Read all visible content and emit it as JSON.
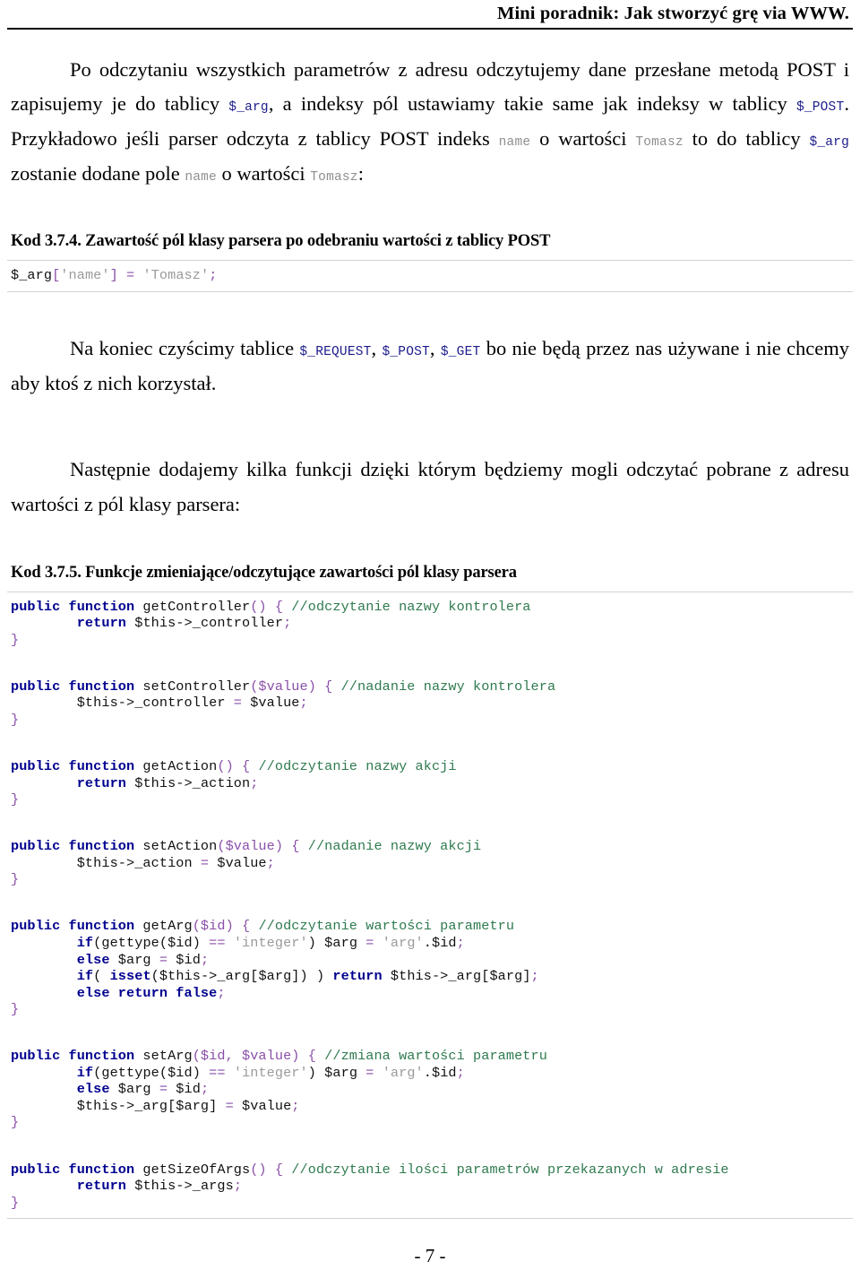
{
  "header": {
    "title": "Mini poradnik: Jak stworzyć grę via WWW."
  },
  "paragraphs": {
    "p1": {
      "part1": "Po odczytaniu wszystkich parametrów z adresu odczytujemy dane przesłane metodą POST i zapisujemy je do tablicy ",
      "code1": "$_arg",
      "part2": ", a indeksy pól ustawiamy takie same jak indeksy w tablicy ",
      "code2": "$_POST",
      "part3": ". Przykładowo jeśli parser odczyta z tablicy POST indeks ",
      "code3": "name",
      "part4": " o wartości ",
      "code4": "Tomasz",
      "part5": " to do tablicy ",
      "code5": "$_arg",
      "part6": " zostanie dodane pole ",
      "code6": "name",
      "part7": " o wartości ",
      "code7": "Tomasz",
      "part8": ":"
    },
    "p2": {
      "part1": "Na koniec czyścimy tablice ",
      "code1": "$_REQUEST",
      "part2": ", ",
      "code2": "$_POST",
      "part3": ", ",
      "code3": "$_GET",
      "part4": " bo nie będą przez nas używane i nie chcemy aby ktoś z nich korzystał."
    },
    "p3": {
      "text": "Następnie dodajemy kilka funkcji dzięki którym będziemy mogli odczytać pobrane z adresu wartości z pól klasy parsera:"
    }
  },
  "listings": [
    {
      "caption": "Kod 3.7.4. Zawartość pól klasy parsera po odebraniu wartości z tablicy POST",
      "code_plain": "$_arg['name'] = 'Tomasz';"
    },
    {
      "caption": "Kod 3.7.5. Funkcje zmieniające/odczytujące zawartości pól klasy parsera",
      "code_plain": "public function getController() { //odczytanie nazwy kontrolera\n        return $this->_controller;\n}\n\npublic function setController($value) { //nadanie nazwy kontrolera\n        $this->_controller = $value;\n}\n\npublic function getAction() { //odczytanie nazwy akcji\n        return $this->_action;\n}\n\npublic function setAction($value) { //nadanie nazwy akcji\n        $this->_action = $value;\n}\n\npublic function getArg($id) { //odczytanie wartości parametru\n        if(gettype($id) == 'integer') $arg = 'arg'.$id;\n        else $arg = $id;\n        if( isset($this->_arg[$arg]) ) return $this->_arg[$arg];\n        else return false;\n}\n\npublic function setArg($id, $value) { //zmiana wartości parametru\n        if(gettype($id) == 'integer') $arg = 'arg'.$id;\n        else $arg = $id;\n        $this->_arg[$arg] = $value;\n}\n\npublic function getSizeOfArgs() { //odczytanie ilości parametrów przekazanych w adresie\n        return $this->_args;\n}"
    }
  ],
  "code_tokens": {
    "listing1": [
      [
        {
          "t": "$_arg",
          "c": "var"
        },
        {
          "t": "[",
          "c": "punc"
        },
        {
          "t": "'name'",
          "c": "str"
        },
        {
          "t": "]",
          "c": "punc"
        },
        {
          "t": " ",
          "c": "var"
        },
        {
          "t": "=",
          "c": "op"
        },
        {
          "t": " ",
          "c": "var"
        },
        {
          "t": "'Tomasz'",
          "c": "str"
        },
        {
          "t": ";",
          "c": "punc"
        }
      ]
    ],
    "listing2": [
      [
        {
          "t": "public function",
          "c": "kw"
        },
        {
          "t": " getController",
          "c": "fn"
        },
        {
          "t": "()",
          "c": "punc"
        },
        {
          "t": " ",
          "c": "var"
        },
        {
          "t": "{",
          "c": "punc"
        },
        {
          "t": " //odczytanie nazwy kontrolera",
          "c": "cmt"
        }
      ],
      [
        {
          "t": "        ",
          "c": "var"
        },
        {
          "t": "return",
          "c": "kw"
        },
        {
          "t": " $this->_controller",
          "c": "var"
        },
        {
          "t": ";",
          "c": "punc"
        }
      ],
      [
        {
          "t": "}",
          "c": "punc"
        }
      ],
      [
        {
          "t": "",
          "c": "blank"
        }
      ],
      [
        {
          "t": "public function",
          "c": "kw"
        },
        {
          "t": " setController",
          "c": "fn"
        },
        {
          "t": "($value)",
          "c": "punc"
        },
        {
          "t": " ",
          "c": "var"
        },
        {
          "t": "{",
          "c": "punc"
        },
        {
          "t": " //nadanie nazwy kontrolera",
          "c": "cmt"
        }
      ],
      [
        {
          "t": "        $this->_controller ",
          "c": "var"
        },
        {
          "t": "=",
          "c": "op"
        },
        {
          "t": " $value",
          "c": "var"
        },
        {
          "t": ";",
          "c": "punc"
        }
      ],
      [
        {
          "t": "}",
          "c": "punc"
        }
      ],
      [
        {
          "t": "",
          "c": "blank"
        }
      ],
      [
        {
          "t": "public function",
          "c": "kw"
        },
        {
          "t": " getAction",
          "c": "fn"
        },
        {
          "t": "()",
          "c": "punc"
        },
        {
          "t": " ",
          "c": "var"
        },
        {
          "t": "{",
          "c": "punc"
        },
        {
          "t": " //odczytanie nazwy akcji",
          "c": "cmt"
        }
      ],
      [
        {
          "t": "        ",
          "c": "var"
        },
        {
          "t": "return",
          "c": "kw"
        },
        {
          "t": " $this->_action",
          "c": "var"
        },
        {
          "t": ";",
          "c": "punc"
        }
      ],
      [
        {
          "t": "}",
          "c": "punc"
        }
      ],
      [
        {
          "t": "",
          "c": "blank"
        }
      ],
      [
        {
          "t": "public function",
          "c": "kw"
        },
        {
          "t": " setAction",
          "c": "fn"
        },
        {
          "t": "($value)",
          "c": "punc"
        },
        {
          "t": " ",
          "c": "var"
        },
        {
          "t": "{",
          "c": "punc"
        },
        {
          "t": " //nadanie nazwy akcji",
          "c": "cmt"
        }
      ],
      [
        {
          "t": "        $this->_action ",
          "c": "var"
        },
        {
          "t": "=",
          "c": "op"
        },
        {
          "t": " $value",
          "c": "var"
        },
        {
          "t": ";",
          "c": "punc"
        }
      ],
      [
        {
          "t": "}",
          "c": "punc"
        }
      ],
      [
        {
          "t": "",
          "c": "blank"
        }
      ],
      [
        {
          "t": "public function",
          "c": "kw"
        },
        {
          "t": " getArg",
          "c": "fn"
        },
        {
          "t": "($id)",
          "c": "punc"
        },
        {
          "t": " ",
          "c": "var"
        },
        {
          "t": "{",
          "c": "punc"
        },
        {
          "t": " //odczytanie wartości parametru",
          "c": "cmt"
        }
      ],
      [
        {
          "t": "        ",
          "c": "var"
        },
        {
          "t": "if",
          "c": "kw"
        },
        {
          "t": "(gettype($id) ",
          "c": "var"
        },
        {
          "t": "==",
          "c": "op"
        },
        {
          "t": " ",
          "c": "var"
        },
        {
          "t": "'integer'",
          "c": "str"
        },
        {
          "t": ") $arg ",
          "c": "var"
        },
        {
          "t": "=",
          "c": "op"
        },
        {
          "t": " ",
          "c": "var"
        },
        {
          "t": "'arg'",
          "c": "str"
        },
        {
          "t": ".$id",
          "c": "var"
        },
        {
          "t": ";",
          "c": "punc"
        }
      ],
      [
        {
          "t": "        ",
          "c": "var"
        },
        {
          "t": "else",
          "c": "kw"
        },
        {
          "t": " $arg ",
          "c": "var"
        },
        {
          "t": "=",
          "c": "op"
        },
        {
          "t": " $id",
          "c": "var"
        },
        {
          "t": ";",
          "c": "punc"
        }
      ],
      [
        {
          "t": "        ",
          "c": "var"
        },
        {
          "t": "if",
          "c": "kw"
        },
        {
          "t": "( ",
          "c": "var"
        },
        {
          "t": "isset",
          "c": "kw"
        },
        {
          "t": "($this->_arg[$arg]) ) ",
          "c": "var"
        },
        {
          "t": "return",
          "c": "kw"
        },
        {
          "t": " $this->_arg[$arg]",
          "c": "var"
        },
        {
          "t": ";",
          "c": "punc"
        }
      ],
      [
        {
          "t": "        ",
          "c": "var"
        },
        {
          "t": "else return false",
          "c": "kw"
        },
        {
          "t": ";",
          "c": "punc"
        }
      ],
      [
        {
          "t": "}",
          "c": "punc"
        }
      ],
      [
        {
          "t": "",
          "c": "blank"
        }
      ],
      [
        {
          "t": "public function",
          "c": "kw"
        },
        {
          "t": " setArg",
          "c": "fn"
        },
        {
          "t": "($id, $value)",
          "c": "punc"
        },
        {
          "t": " ",
          "c": "var"
        },
        {
          "t": "{",
          "c": "punc"
        },
        {
          "t": " //zmiana wartości parametru",
          "c": "cmt"
        }
      ],
      [
        {
          "t": "        ",
          "c": "var"
        },
        {
          "t": "if",
          "c": "kw"
        },
        {
          "t": "(gettype($id) ",
          "c": "var"
        },
        {
          "t": "==",
          "c": "op"
        },
        {
          "t": " ",
          "c": "var"
        },
        {
          "t": "'integer'",
          "c": "str"
        },
        {
          "t": ") $arg ",
          "c": "var"
        },
        {
          "t": "=",
          "c": "op"
        },
        {
          "t": " ",
          "c": "var"
        },
        {
          "t": "'arg'",
          "c": "str"
        },
        {
          "t": ".$id",
          "c": "var"
        },
        {
          "t": ";",
          "c": "punc"
        }
      ],
      [
        {
          "t": "        ",
          "c": "var"
        },
        {
          "t": "else",
          "c": "kw"
        },
        {
          "t": " $arg ",
          "c": "var"
        },
        {
          "t": "=",
          "c": "op"
        },
        {
          "t": " $id",
          "c": "var"
        },
        {
          "t": ";",
          "c": "punc"
        }
      ],
      [
        {
          "t": "        $this->_arg[$arg] ",
          "c": "var"
        },
        {
          "t": "=",
          "c": "op"
        },
        {
          "t": " $value",
          "c": "var"
        },
        {
          "t": ";",
          "c": "punc"
        }
      ],
      [
        {
          "t": "}",
          "c": "punc"
        }
      ],
      [
        {
          "t": "",
          "c": "blank"
        }
      ],
      [
        {
          "t": "public function",
          "c": "kw"
        },
        {
          "t": " getSizeOfArgs",
          "c": "fn"
        },
        {
          "t": "()",
          "c": "punc"
        },
        {
          "t": " ",
          "c": "var"
        },
        {
          "t": "{",
          "c": "punc"
        },
        {
          "t": " //odczytanie ilości parametrów przekazanych w adresie",
          "c": "cmt"
        }
      ],
      [
        {
          "t": "        ",
          "c": "var"
        },
        {
          "t": "return",
          "c": "kw"
        },
        {
          "t": " $this->_args",
          "c": "var"
        },
        {
          "t": ";",
          "c": "punc"
        }
      ],
      [
        {
          "t": "}",
          "c": "punc"
        }
      ]
    ]
  },
  "footer": {
    "page_number": "- 7 -"
  },
  "colors": {
    "keyword": "#00008f",
    "comment": "#2f7a4f",
    "punctuation": "#8a4fa8",
    "string": "#9a9a9a",
    "inline_var": "#1c1c8c",
    "inline_literal": "#8f8f8f",
    "rule": "#d3d3d3"
  }
}
